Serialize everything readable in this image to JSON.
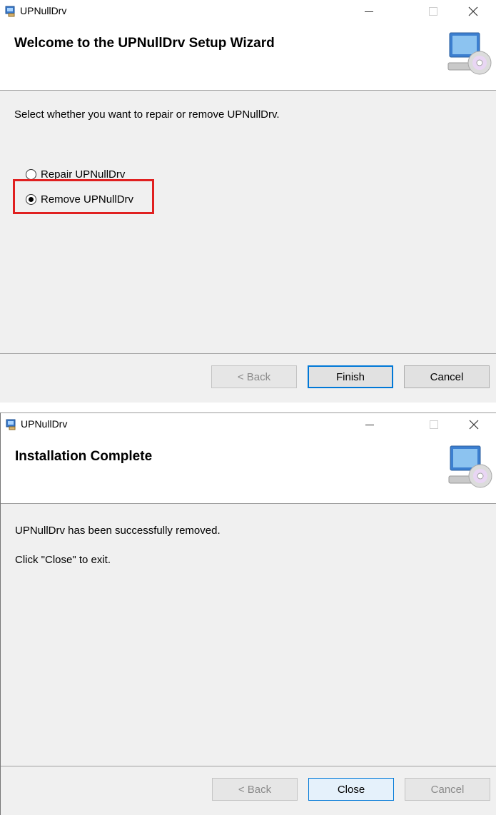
{
  "window1": {
    "title": "UPNullDrv",
    "header_title": "Welcome to the UPNullDrv Setup Wizard",
    "prompt": "Select whether you want to repair or remove UPNullDrv.",
    "options": [
      {
        "label": "Repair UPNullDrv",
        "selected": false
      },
      {
        "label": "Remove UPNullDrv",
        "selected": true
      }
    ],
    "buttons": {
      "back": "< Back",
      "finish": "Finish",
      "cancel": "Cancel"
    }
  },
  "window2": {
    "title": "UPNullDrv",
    "header_title": "Installation Complete",
    "message1": "UPNullDrv has been successfully removed.",
    "message2": "Click \"Close\" to exit.",
    "buttons": {
      "back": "< Back",
      "close": "Close",
      "cancel": "Cancel"
    }
  },
  "colors": {
    "highlight": "#e02020",
    "focus_border": "#0078d7"
  },
  "icons": [
    "installer-icon",
    "minimize-icon",
    "maximize-icon",
    "close-icon",
    "computer-cd-icon"
  ]
}
